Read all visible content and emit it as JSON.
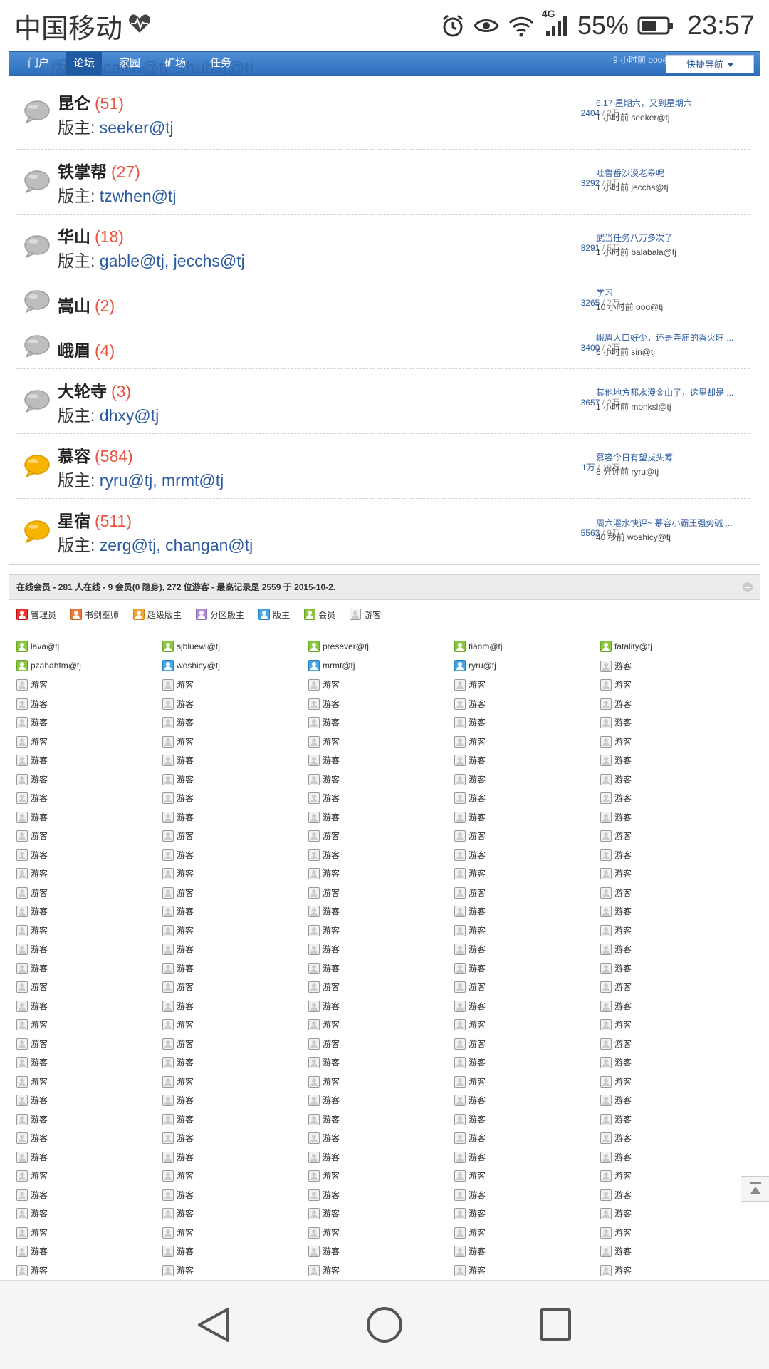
{
  "status": {
    "carrier": "中国移动",
    "network": "4G",
    "battery": "55%",
    "time": "23:57"
  },
  "nav": {
    "items": [
      {
        "label": "门户",
        "active": false
      },
      {
        "label": "论坛",
        "active": true
      },
      {
        "label": "家园",
        "active": false
      },
      {
        "label": "矿场",
        "active": false
      },
      {
        "label": "任务",
        "active": false
      }
    ],
    "ghost_text": "版主: scallia@tj, shubig@tj",
    "ghost_right": "9 小时前 ooo@tj",
    "quick_nav": "快捷导航"
  },
  "forums": [
    {
      "name": "昆仑",
      "count": "(51)",
      "mods_label": "版主: ",
      "mods": "seeker@tj",
      "stats": "2404",
      "total": " / 2万",
      "last_title": "6.17 星期六，又到星期六",
      "last_by": "1 小时前 seeker@tj",
      "active": false
    },
    {
      "name": "铁掌帮",
      "count": "(27)",
      "mods_label": "版主: ",
      "mods": "tzwhen@tj",
      "stats": "3292",
      "total": " / 3万",
      "last_title": "吐鲁番沙漠老皋呢",
      "last_by": "1 小时前 jecchs@tj",
      "active": false
    },
    {
      "name": "华山",
      "count": "(18)",
      "mods_label": "版主: ",
      "mods": "gable@tj, jecchs@tj",
      "stats": "8291",
      "total": " / 5万",
      "last_title": "武当任务八万多次了",
      "last_by": "1 小时前 balabala@tj",
      "active": false
    },
    {
      "name": "嵩山",
      "count": "(2)",
      "mods_label": "",
      "mods": "",
      "stats": "3265",
      "total": " / 2万",
      "last_title": "学习",
      "last_by": "10 小时前 ooo@tj",
      "active": false
    },
    {
      "name": "峨眉",
      "count": "(4)",
      "mods_label": "",
      "mods": "",
      "stats": "3400",
      "total": " / 2万",
      "last_title": "峨眉人口好少，还是寺庙的香火旺 ...",
      "last_by": "6 小时前 sin@tj",
      "active": false
    },
    {
      "name": "大轮寺",
      "count": "(3)",
      "mods_label": "版主: ",
      "mods": "dhxy@tj",
      "stats": "3657",
      "total": " / 2万",
      "last_title": "其他地方都水漫金山了，这里却是 ...",
      "last_by": "1 小时前 monksl@tj",
      "active": false
    },
    {
      "name": "慕容",
      "count": "(584)",
      "mods_label": "版主: ",
      "mods": "ryru@tj, mrmt@tj",
      "stats": "1万",
      "total": " / 10万",
      "last_title": "慕容今日有望拔头筹",
      "last_by": "8 分钟前 ryru@tj",
      "active": true
    },
    {
      "name": "星宿",
      "count": "(511)",
      "mods_label": "版主: ",
      "mods": "zerg@tj, changan@tj",
      "stats": "5563",
      "total": " / 9万",
      "last_title": "周六灌水快评~ 慕容小霸王强势碱 ...",
      "last_by": "40 秒前 woshicy@tj",
      "active": true
    }
  ],
  "online": {
    "header": "在线会员 - 281 人在线 - 9 会员(0 隐身), 272 位游客 - 最高记录是 2559 于 2015-10-2.",
    "legend": [
      {
        "label": "管理员",
        "type": "admin"
      },
      {
        "label": "书剑巫师",
        "type": "wizard"
      },
      {
        "label": "超级版主",
        "type": "super"
      },
      {
        "label": "分区版主",
        "type": "zone"
      },
      {
        "label": "版主",
        "type": "mod"
      },
      {
        "label": "会员",
        "type": "member"
      },
      {
        "label": "游客",
        "type": "guest"
      }
    ],
    "users": [
      {
        "name": "lava@tj",
        "type": "member"
      },
      {
        "name": "sjbluewi@tj",
        "type": "member"
      },
      {
        "name": "presever@tj",
        "type": "member"
      },
      {
        "name": "tianm@tj",
        "type": "member"
      },
      {
        "name": "fatality@tj",
        "type": "member"
      },
      {
        "name": "pzahahfm@tj",
        "type": "member"
      },
      {
        "name": "woshicy@tj",
        "type": "mod"
      },
      {
        "name": "mrmt@tj",
        "type": "mod"
      },
      {
        "name": "ryru@tj",
        "type": "mod"
      }
    ],
    "guest_label": "游客",
    "guest_count_visible": 161
  },
  "icons": [
    "heart-pulse-icon",
    "alarm-icon",
    "eye-icon",
    "wifi-icon",
    "signal-icon",
    "battery-icon",
    "speech-bubble-icon",
    "back-icon",
    "home-icon",
    "recents-icon",
    "collapse-icon",
    "back-to-top-icon"
  ]
}
